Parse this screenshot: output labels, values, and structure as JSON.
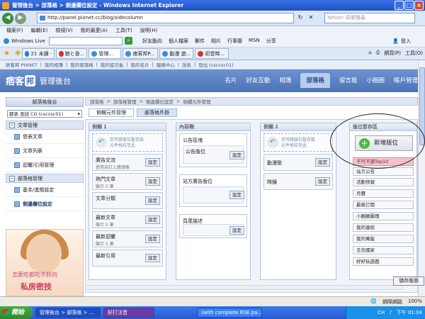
{
  "window": {
    "title": "管理後台 > 部落格 > 側邊欄位設定 - Windows Internet Explorer"
  },
  "address": {
    "url": "http://panel.pixnet.cc/blog/sidecolumn",
    "search_placeholder": "Yahoo! 奇摩搜尋"
  },
  "menu": [
    "檔案(F)",
    "編輯(E)",
    "檢視(V)",
    "我的最愛(A)",
    "工具(T)",
    "說明(H)"
  ],
  "live": {
    "label": "Windows Live",
    "links": [
      "好友動向",
      "個人檔案",
      "郵件",
      "相片",
      "行事曆",
      "MSN",
      "分享"
    ],
    "login": "登入"
  },
  "browser_tabs": [
    "21 未讀 -",
    "狼と香...",
    "管理...",
    "痞客邦P...",
    "動漫 遊...",
    "初音時..."
  ],
  "tab_tools": [
    "網頁(P)",
    "工具(O)"
  ],
  "toplinks": [
    "痞客邦 PIXNET",
    "我的相簿",
    "我的部落格",
    "我的留言板",
    "我的名片",
    "服務中心",
    "語系",
    "登出 (csccsc01)"
  ],
  "header": {
    "logo": "痞客",
    "logo_badge": "邦",
    "subtitle": "管理後台",
    "nav": [
      "名片",
      "好友互動",
      "相簿",
      "部落格",
      "留言板",
      "小圈圈",
      "帳戶管理"
    ],
    "active_nav": "部落格"
  },
  "sidebar": {
    "title": "部落格後台",
    "blog_select": "鄒承 測試 CG (csccsc01)",
    "sections": [
      {
        "title": "文章管理",
        "items": [
          "發表文章",
          "文章列表",
          "迴響/引用管理"
        ]
      },
      {
        "title": "部落格管理",
        "items": [
          "基本/進階設定",
          "側邊欄位設定"
        ]
      }
    ],
    "ad": {
      "line1": "怎麼吃都吃不胖的",
      "line2": "私房密技"
    }
  },
  "breadcrumb": [
    "部落格",
    "部落格管理",
    "側邊欄位設定",
    "側欄元件管理"
  ],
  "subtabs": [
    "側欄元件管理",
    "部落格外掛"
  ],
  "drop_hint": [
    "您可將版位暫存區",
    "元件拖拉至此"
  ],
  "set_label": "設定",
  "columns": {
    "col1": {
      "title": "側欄 1",
      "modules": [
        {
          "name": "廣告交流",
          "sub": "使用自訂上廣頭像"
        },
        {
          "name": "熱門文章",
          "sub": "顯示 5 筆"
        },
        {
          "name": "文章分類",
          "sub": ""
        },
        {
          "name": "最新文章",
          "sub": "顯示 5 筆"
        },
        {
          "name": "最新迴響",
          "sub": "顯示 5 筆"
        },
        {
          "name": "最新引用",
          "sub": ""
        }
      ]
    },
    "main": {
      "title": "內容欄",
      "boxes": [
        {
          "title": "公告區塊",
          "inner": "公告版位"
        },
        {
          "title": "站方廣告版位",
          "inner": ""
        },
        {
          "title": "頁尾描述",
          "inner": ""
        }
      ]
    },
    "col2": {
      "title": "側欄 2",
      "modules": [
        {
          "name": "動漫歌",
          "sub": ""
        },
        {
          "name": "時鐘",
          "sub": ""
        }
      ]
    }
  },
  "storage": {
    "title": "版位暫存區",
    "add_button": "新增版位",
    "items": [
      "不可不讀Top10",
      "站方公告",
      "活動快報",
      "月曆",
      "最新訂閱",
      "小圈圈圖塊",
      "我的連結",
      "我的萬能",
      "去去國家",
      "好好玩遊戲"
    ]
  },
  "save_button": "儲存版面",
  "status": {
    "zone": "網際網路",
    "zoom": "100%"
  },
  "taskbar": {
    "start": "開始",
    "tasks": [
      "管理後台 > 部落格 > ...",
      "好打注音",
      "(with complete RSE pa..."
    ],
    "lang": "CH",
    "clock": "下午 01:04"
  }
}
